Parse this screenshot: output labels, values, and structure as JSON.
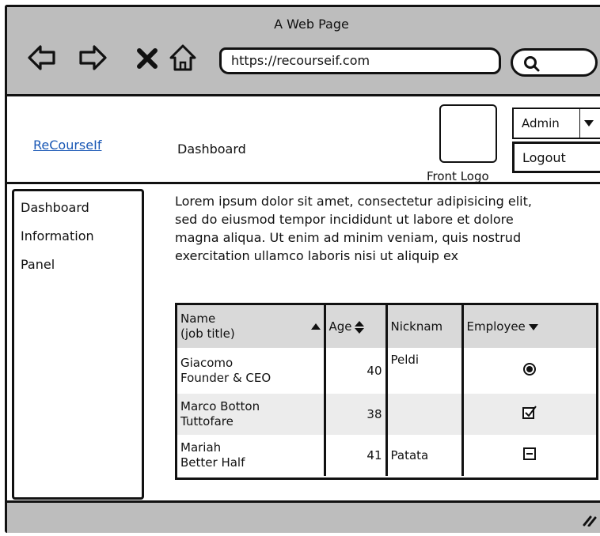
{
  "window": {
    "title": "A Web Page"
  },
  "browser": {
    "url": "https://recourseif.com",
    "icons": [
      "back-arrow-icon",
      "forward-arrow-icon",
      "close-icon",
      "home-icon",
      "search-icon"
    ]
  },
  "header": {
    "logo_link": "ReCourseIf",
    "title": "Dashboard",
    "logo_caption": "Front Logo",
    "user_select": "Admin",
    "logout_label": "Logout"
  },
  "sidebar": {
    "items": [
      {
        "label": "Dashboard"
      },
      {
        "label": "Information"
      },
      {
        "label": "Panel"
      }
    ]
  },
  "main": {
    "paragraph": "Lorem ipsum dolor sit amet, consectetur adipisicing elit, sed do eiusmod tempor incididunt ut labore et dolore magna aliqua. Ut enim ad minim veniam, quis nostrud exercitation ullamco laboris nisi ut aliquip ex",
    "table": {
      "headers": {
        "name_line1": "Name",
        "name_line2": "(job title)",
        "age": "Age",
        "nickname": "Nicknam",
        "employee": "Employee"
      },
      "rows": [
        {
          "name": "Giacomo",
          "title": "Founder & CEO",
          "age": "40",
          "nickname": "Peldi",
          "employee": "radio-selected-icon"
        },
        {
          "name": "Marco Botton",
          "title": "Tuttofare",
          "age": "38",
          "nickname": "",
          "employee": "checkbox-checked-icon"
        },
        {
          "name": "Mariah",
          "title": "Better Half",
          "age": "41",
          "nickname": "Patata",
          "employee": "checkbox-indeterminate-icon"
        }
      ]
    }
  },
  "colors": {
    "chrome": "#bdbdbd",
    "link": "#1a58b5",
    "header_row": "#d9d9d9",
    "alt_row": "#ececec"
  }
}
